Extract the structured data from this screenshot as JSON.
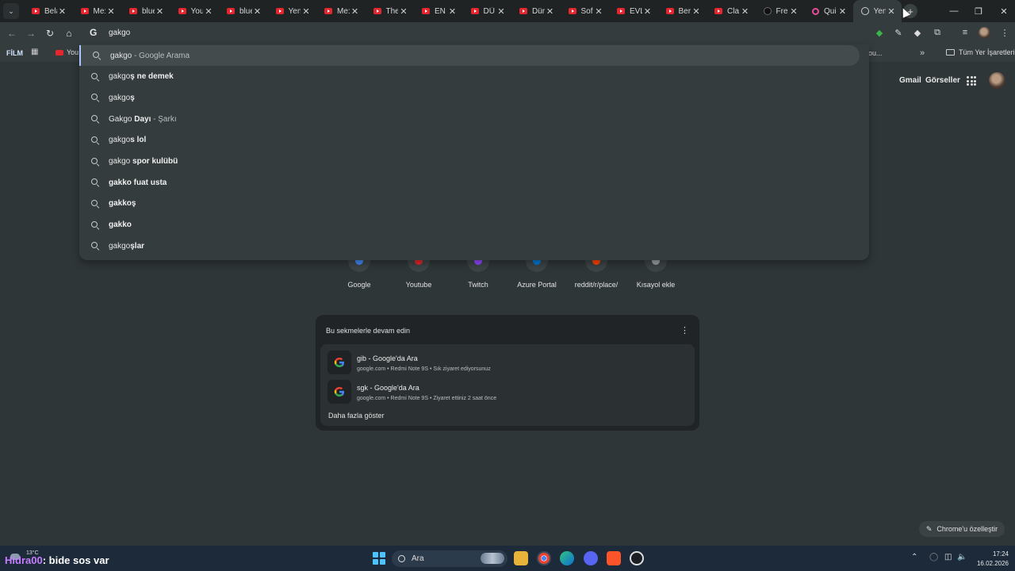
{
  "tabs": [
    {
      "title": "Bela",
      "icon": "youtube-icon"
    },
    {
      "title": "Me:",
      "icon": "youtube-icon"
    },
    {
      "title": "blue",
      "icon": "youtube-icon"
    },
    {
      "title": "You",
      "icon": "youtube-icon"
    },
    {
      "title": "blue",
      "icon": "youtube-icon"
    },
    {
      "title": "Yen",
      "icon": "youtube-icon"
    },
    {
      "title": "Me:",
      "icon": "youtube-icon"
    },
    {
      "title": "The",
      "icon": "youtube-icon"
    },
    {
      "title": "EN",
      "icon": "youtube-icon"
    },
    {
      "title": "DÜ",
      "icon": "youtube-icon"
    },
    {
      "title": "Dür",
      "icon": "youtube-icon"
    },
    {
      "title": "Sof",
      "icon": "youtube-icon"
    },
    {
      "title": "EVL",
      "icon": "youtube-icon"
    },
    {
      "title": "Ber",
      "icon": "youtube-icon"
    },
    {
      "title": "Cla",
      "icon": "youtube-icon"
    },
    {
      "title": "Fre",
      "icon": "dark-site-icon"
    },
    {
      "title": "Qui",
      "icon": "quiz-icon"
    },
    {
      "title": "Yen",
      "icon": "chrome-icon",
      "active": true
    }
  ],
  "omnibox": {
    "value": "gakgo"
  },
  "bookmarks": {
    "film": "FİLM",
    "youtube": "You",
    "truncated": "ou...",
    "more": "»",
    "all": "Tüm Yer İşaretleri"
  },
  "suggestions": [
    {
      "typed": "gakgo",
      "bold": "",
      "suffix": " - Google Arama",
      "selected": true
    },
    {
      "typed": "gakgo",
      "bold": "ş ne demek",
      "suffix": ""
    },
    {
      "typed": "gakgo",
      "bold": "ş",
      "suffix": ""
    },
    {
      "typed": "Gakgo ",
      "bold": "Dayı",
      "suffix": " - Şarkı"
    },
    {
      "typed": "gakgo",
      "bold": "s lol",
      "suffix": ""
    },
    {
      "typed": "gakgo ",
      "bold": "spor kulübü",
      "suffix": ""
    },
    {
      "typed": "",
      "bold": "gakko fuat usta",
      "suffix": ""
    },
    {
      "typed": "",
      "bold": "gakkoş",
      "suffix": ""
    },
    {
      "typed": "",
      "bold": "gakko",
      "suffix": ""
    },
    {
      "typed": "gakgo",
      "bold": "şlar",
      "suffix": ""
    }
  ],
  "header": {
    "gmail": "Gmail",
    "images": "Görseller"
  },
  "shortcuts": [
    {
      "label": "Google",
      "color": "#4285f4"
    },
    {
      "label": "Youtube",
      "color": "#e4262f"
    },
    {
      "label": "Twitch",
      "color": "#9146ff"
    },
    {
      "label": "Azure Portal",
      "color": "#0078d4"
    },
    {
      "label": "reddit/r/place/",
      "color": "#ff4500"
    },
    {
      "label": "Kısayol ekle",
      "color": "#9aa0a3"
    }
  ],
  "continue_card": {
    "title": "Bu sekmelerle devam edin",
    "items": [
      {
        "title": "gib - Google'da Ara",
        "sub": "google.com • Redmi Note 9S • Sık ziyaret ediyorsunuz"
      },
      {
        "title": "sgk - Google'da Ara",
        "sub": "google.com • Redmi Note 9S • Ziyaret ettiniz 2 saat önce"
      }
    ],
    "more": "Daha fazla göster"
  },
  "customize": "Chrome'u özelleştir",
  "taskbar": {
    "temperature": "13°C",
    "overlay_nick": "Hidra00",
    "overlay_msg": ": bide sos var",
    "search": "Ara",
    "time": "17:24",
    "date": "16.02.2026"
  },
  "colors": {
    "page_bg": "#2f3638",
    "tabstrip_bg": "#1f2324",
    "accent": "#a9c7ff",
    "taskbar_bg": "#1c2a3a"
  }
}
